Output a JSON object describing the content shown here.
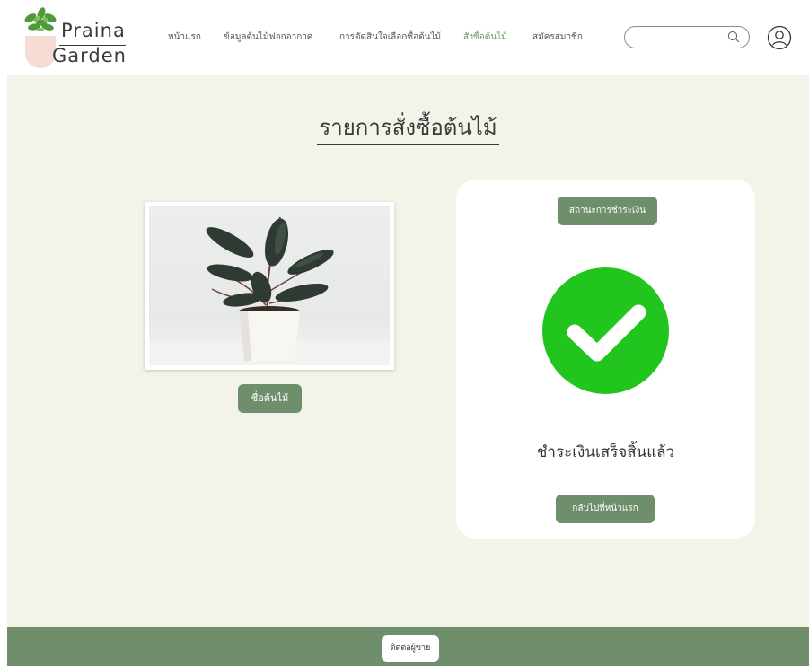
{
  "header": {
    "logo": {
      "line1": "Praina",
      "line2": "Garden"
    },
    "nav": [
      {
        "label": "หน้าแรก",
        "active": false
      },
      {
        "label": "ข้อมูลต้นไม้ฟอกอากาศ",
        "active": false
      },
      {
        "label": "การตัดสินใจเลือกซื้อต้นไม้",
        "active": false
      },
      {
        "label": "สั่งซื้อต้นไม้",
        "active": true
      },
      {
        "label": "สมัครสมาชิก",
        "active": false
      }
    ],
    "search": {
      "placeholder": "",
      "icon": "search-icon"
    },
    "account_icon": "user-icon"
  },
  "main": {
    "title": "รายการสั่งซื้อต้นไม้",
    "plant_name_button": "ชื่อต้นไม้",
    "status_card": {
      "status_button": "สถานะการชำระเงิน",
      "icon": "check-circle-icon",
      "message": "ชำระเงินเสร็จสิ้นแล้ว",
      "home_button": "กลับไปที่หน้าแรก"
    }
  },
  "footer": {
    "contact_button": "ติดต่อผู้ขาย"
  },
  "colors": {
    "accent_green": "#6f8f6c",
    "active_nav": "#6b9a63",
    "background": "#f4f3ea",
    "success": "#22c41e",
    "logo_pot": "#f6dcd3"
  }
}
